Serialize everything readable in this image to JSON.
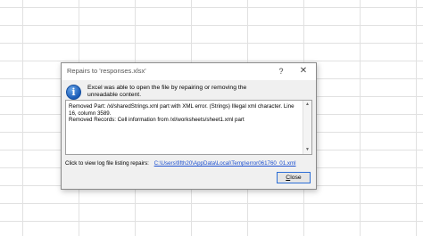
{
  "dialog": {
    "title": "Repairs to 'responses.xlsx'",
    "help_glyph": "?",
    "close_glyph": "✕",
    "info_glyph": "i",
    "message": "Excel was able to open the file by repairing or removing the unreadable content.",
    "details": "Removed Part: /xl/sharedStrings.xml part with XML error.  (Strings) Illegal xml character. Line 16, column 3589.\nRemoved Records: Cell information from /xl/worksheets/sheet1.xml part",
    "log_label": "Click to view log file listing repairs:",
    "log_link": "C:\\Users\\fifth20\\AppData\\Local\\Temp\\error061760_01.xml",
    "close_button_first": "C",
    "close_button_rest": "lose"
  },
  "scrollbar": {
    "up_glyph": "▲",
    "down_glyph": "▼"
  },
  "colors": {
    "link": "#1c4fd0",
    "info_icon": "#1a5cb8",
    "button_border": "#2d6fd6"
  }
}
